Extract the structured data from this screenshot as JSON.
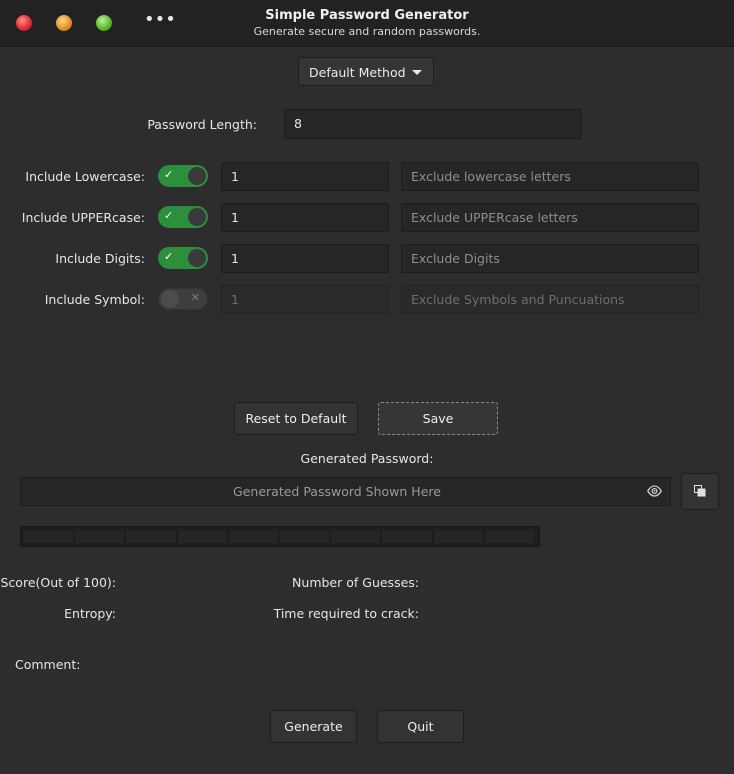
{
  "window": {
    "title": "Simple Password Generator",
    "subtitle": "Generate secure and random passwords.",
    "menu_icon": "more-horizontal-icon"
  },
  "method": {
    "selected": "Default Method"
  },
  "length": {
    "label": "Password Length:",
    "value": "8"
  },
  "options": [
    {
      "label": "Include Lowercase:",
      "enabled": true,
      "count": "1",
      "exclude_placeholder": "Exclude lowercase letters"
    },
    {
      "label": "Include UPPERcase:",
      "enabled": true,
      "count": "1",
      "exclude_placeholder": "Exclude UPPERcase letters"
    },
    {
      "label": "Include Digits:",
      "enabled": true,
      "count": "1",
      "exclude_placeholder": "Exclude Digits"
    },
    {
      "label": "Include Symbol:",
      "enabled": false,
      "count": "1",
      "exclude_placeholder": "Exclude Symbols and Puncuations"
    }
  ],
  "actions": {
    "reset": "Reset to Default",
    "save": "Save"
  },
  "generated": {
    "label": "Generated Password:",
    "placeholder": "Generated Password Shown Here",
    "strength_level": 0
  },
  "stats": {
    "score_label": "Score(Out of 100):",
    "entropy_label": "Entropy:",
    "guesses_label": "Number of Guesses:",
    "crack_time_label": "Time required to crack:",
    "comment_label": "Comment:"
  },
  "footer": {
    "generate": "Generate",
    "quit": "Quit"
  },
  "colors": {
    "switch_on": "#2c8f3c",
    "background": "#2d2d2d",
    "titlebar": "#222222"
  }
}
